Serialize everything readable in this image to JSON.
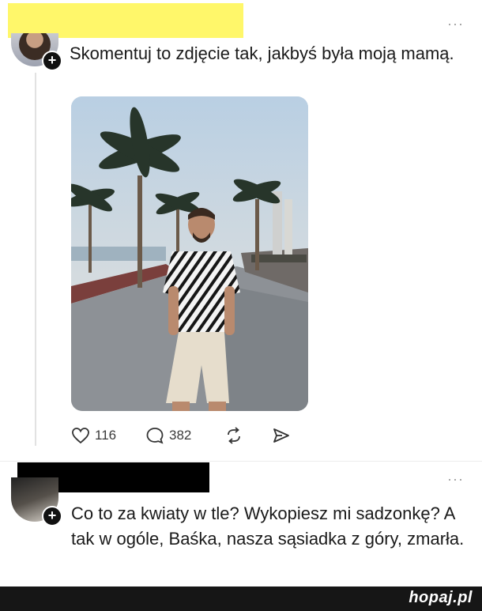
{
  "post1": {
    "text": "Skomentuj to zdjęcie tak, jakbyś była moją mamą.",
    "more": "···",
    "likes": "116",
    "comments": "382"
  },
  "post2": {
    "text": "Co to za kwiaty w tle? Wykopiesz mi sadzonkę? A tak w ogóle, Baśka, nasza sąsiadka z góry, zmarła.",
    "more": "···"
  },
  "footer": {
    "brand": "hopaj.pl"
  },
  "icons": {
    "like": "heart-icon",
    "comment": "speech-bubble-icon",
    "repost": "repost-arrows-icon",
    "share": "send-arrow-icon",
    "follow": "plus-badge-icon"
  },
  "colors": {
    "redaction_top": "#fff76a",
    "redaction_bottom": "#000000",
    "footer": "#161616"
  }
}
